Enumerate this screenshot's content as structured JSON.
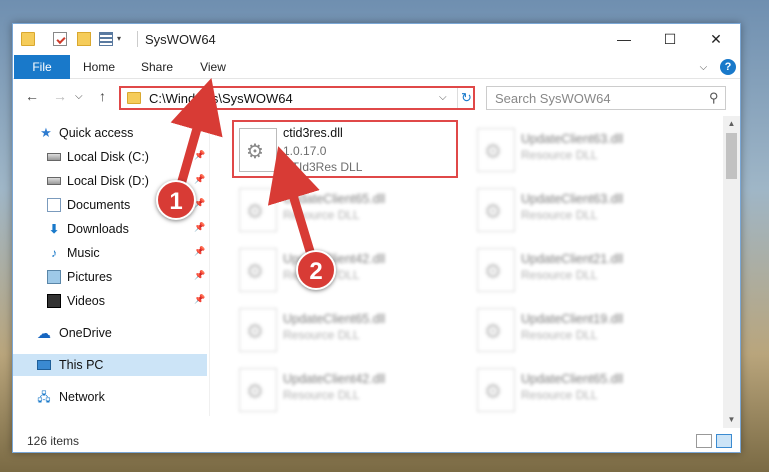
{
  "window": {
    "title": "SysWOW64",
    "controls": {
      "minimize": "—",
      "maximize": "☐",
      "close": "✕"
    }
  },
  "ribbon": {
    "tabs": [
      "File",
      "Home",
      "Share",
      "View"
    ],
    "expand_glyph": "⌵",
    "help_glyph": "?"
  },
  "nav": {
    "back": "←",
    "forward": "→",
    "recent": "⌵",
    "up": "↑",
    "address": "C:\\Windows\\SysWOW64",
    "address_dropdown": "⌵",
    "refresh": "↻",
    "search_placeholder": "Search SysWOW64",
    "search_glyph": "⚲"
  },
  "sidebar": {
    "pin_glyph": "📌",
    "quick_access": {
      "label": "Quick access",
      "icon": "★"
    },
    "items": [
      {
        "label": "Local Disk (C:)",
        "pinned": true
      },
      {
        "label": "Local Disk (D:)",
        "pinned": true
      },
      {
        "label": "Documents",
        "pinned": true
      },
      {
        "label": "Downloads",
        "pinned": true
      },
      {
        "label": "Music",
        "pinned": true
      },
      {
        "label": "Pictures",
        "pinned": true
      },
      {
        "label": "Videos",
        "pinned": true
      }
    ],
    "icons": {
      "downloads": "⬇",
      "music": "♪",
      "onedrive": "☁",
      "network": "🖧"
    },
    "onedrive": "OneDrive",
    "this_pc": "This PC",
    "network": "Network"
  },
  "files": {
    "featured": {
      "name": "ctid3res.dll",
      "version": "1.0.17.0",
      "description": "CTId3Res DLL"
    },
    "right_column": [
      {
        "name": "UpdateClient63.dll",
        "type": "Resource DLL"
      },
      {
        "name": "UpdateClient63.dll",
        "type": "Resource DLL"
      },
      {
        "name": "UpdateClient21.dll",
        "type": "Resource DLL"
      },
      {
        "name": "UpdateClient19.dll",
        "type": "Resource DLL"
      },
      {
        "name": "UpdateClient65.dll",
        "type": "Resource DLL"
      }
    ],
    "left_column": [
      {
        "name": "UpdateClient65.dll",
        "type": "Resource DLL"
      },
      {
        "name": "UpdateClient42.dll",
        "type": "Resource DLL"
      },
      {
        "name": "UpdateClient65.dll",
        "type": "Resource DLL"
      },
      {
        "name": "UpdateClient42.dll",
        "type": "Resource DLL"
      }
    ]
  },
  "scroll": {
    "up": "▲",
    "down": "▼"
  },
  "status": {
    "item_count": "126 items"
  },
  "annotations": {
    "step1": "1",
    "step2": "2",
    "color": "#d83b35"
  }
}
